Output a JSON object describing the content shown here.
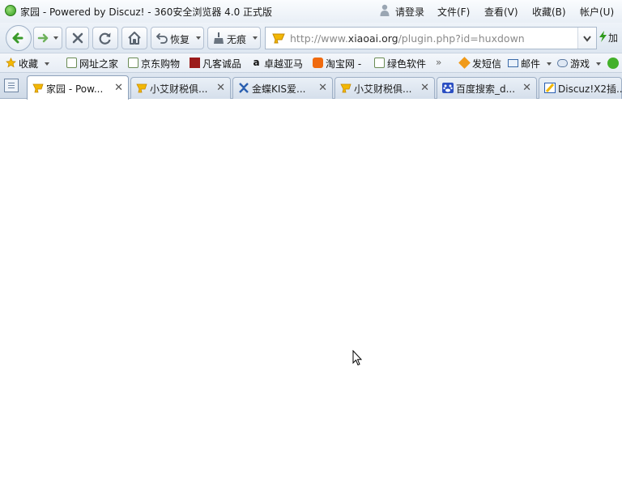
{
  "window": {
    "title": "家园 - Powered by Discuz! - 360安全浏览器 4.0 正式版",
    "login": "请登录",
    "menu": [
      "文件(F)",
      "查看(V)",
      "收藏(B)",
      "帐户(U)"
    ]
  },
  "toolbar": {
    "restore_label": "恢复",
    "incognito_label": "无痕",
    "accelerate_label": "加"
  },
  "address": {
    "prefix": "http://www.",
    "domain": "xiaoai.org",
    "path": "/plugin.php?id=huxdown"
  },
  "favorites": {
    "collect_label": "收藏",
    "items": [
      "网址之家",
      "京东购物",
      "凡客诚品",
      "卓越亚马",
      "淘宝网 -",
      "绿色软件"
    ],
    "more": "»",
    "right_items": [
      "发短信",
      "邮件",
      "游戏"
    ]
  },
  "tabs": [
    {
      "title": "家园 - Pow...",
      "active": true
    },
    {
      "title": "小艾财税俱...",
      "active": false
    },
    {
      "title": "金蝶KIS爱...",
      "active": false
    },
    {
      "title": "小艾财税俱...",
      "active": false
    },
    {
      "title": "百度搜索_d...",
      "active": false
    },
    {
      "title": "Discuz!X2插...",
      "active": false
    }
  ],
  "colors": {
    "accent_green": "#2f9a1c",
    "toolbar_bg": "#dde6f0",
    "tab_active": "#ffffff"
  }
}
